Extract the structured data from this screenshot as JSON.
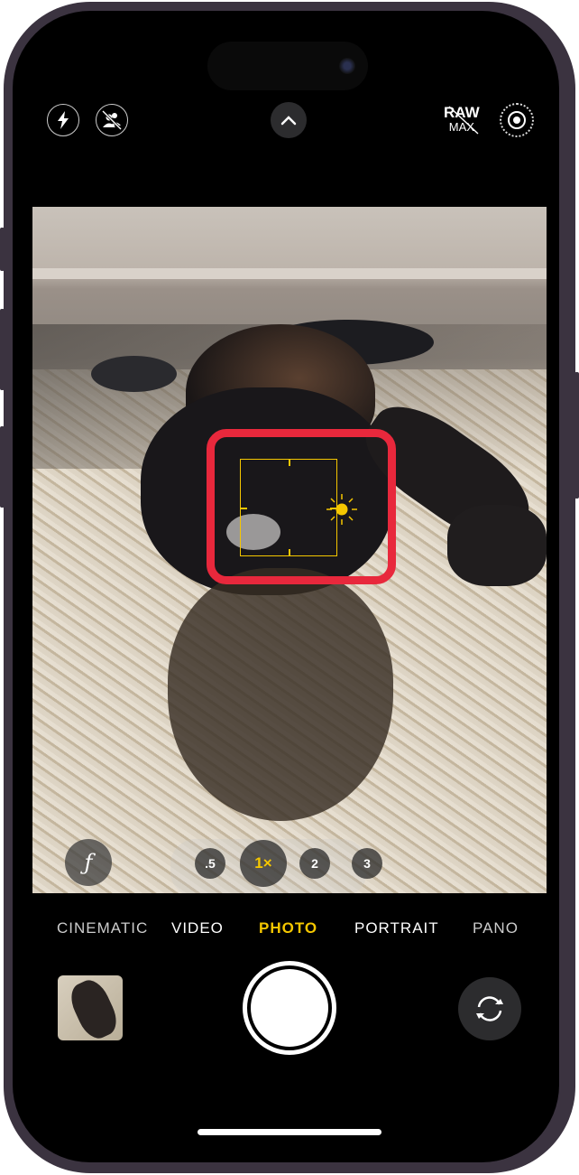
{
  "top_bar": {
    "flash_icon": "bolt-icon",
    "live_icon": "person-slash-icon",
    "expand_icon": "chevron-up-icon",
    "raw_label": "RAW",
    "raw_sub": "MAX",
    "live_photo_icon": "live-photo-icon"
  },
  "viewfinder": {
    "focus_color": "#f5c700",
    "highlight_color": "#e8283c",
    "exposure_icon": "sun-icon"
  },
  "controls": {
    "aperture_label": "ƒ",
    "zoom_levels": [
      ".5",
      "1×",
      "2",
      "3"
    ],
    "zoom_selected": "1×"
  },
  "modes": {
    "items": [
      "CINEMATIC",
      "VIDEO",
      "PHOTO",
      "PORTRAIT",
      "PANO"
    ],
    "selected": "PHOTO",
    "accent": "#f5c700"
  },
  "bottom": {
    "shutter_icon": "shutter-button",
    "flip_icon": "camera-flip-icon"
  }
}
